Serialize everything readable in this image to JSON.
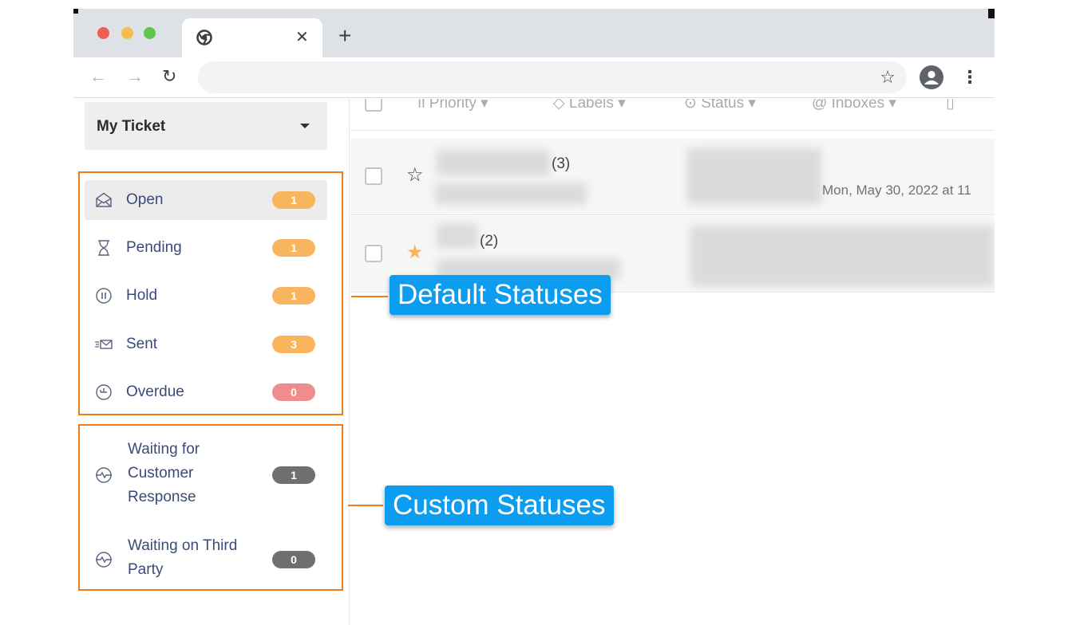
{
  "browser": {
    "tab_title": "",
    "close_glyph": "✕",
    "new_tab_glyph": "+",
    "back_glyph": "←",
    "forward_glyph": "→",
    "reload_glyph": "↻",
    "bookmark_glyph": "☆",
    "menu_glyph": "⋮",
    "address": ""
  },
  "sidebar": {
    "view_selector": "My Ticket",
    "default_statuses": [
      {
        "label": "Open",
        "count": "1",
        "icon": "open-envelope-icon",
        "color": "#f9b55d",
        "active": true
      },
      {
        "label": "Pending",
        "count": "1",
        "icon": "hourglass-icon",
        "color": "#f9b55d"
      },
      {
        "label": "Hold",
        "count": "1",
        "icon": "pause-circle-icon",
        "color": "#f9b55d"
      },
      {
        "label": "Sent",
        "count": "3",
        "icon": "sent-mail-icon",
        "color": "#f9b55d"
      },
      {
        "label": "Overdue",
        "count": "0",
        "icon": "overdue-clock-icon",
        "color": "#f08c8c"
      }
    ],
    "custom_statuses": [
      {
        "label_lines": [
          "Waiting for",
          "Customer",
          "Response"
        ],
        "count": "1",
        "icon": "pulse-circle-icon",
        "color": "#6f6f6f"
      },
      {
        "label_lines": [
          "Waiting on Third",
          "Party"
        ],
        "count": "0",
        "icon": "pulse-circle-icon",
        "color": "#6f6f6f"
      }
    ]
  },
  "list": {
    "header": {
      "priority": "Priority",
      "labels": "Labels",
      "status": "Status",
      "inboxes": "Inboxes"
    },
    "rows": [
      {
        "count": "(3)",
        "starred": false,
        "date": "Mon, May 30, 2022 at 11"
      },
      {
        "count": "(2)",
        "starred": true
      }
    ]
  },
  "annotations": {
    "default": "Default Statuses",
    "custom": "Custom Statuses"
  },
  "colors": {
    "accent_orange": "#f07c1a",
    "callout_blue": "#0d9df0",
    "star_filled": "#f9b55d"
  }
}
